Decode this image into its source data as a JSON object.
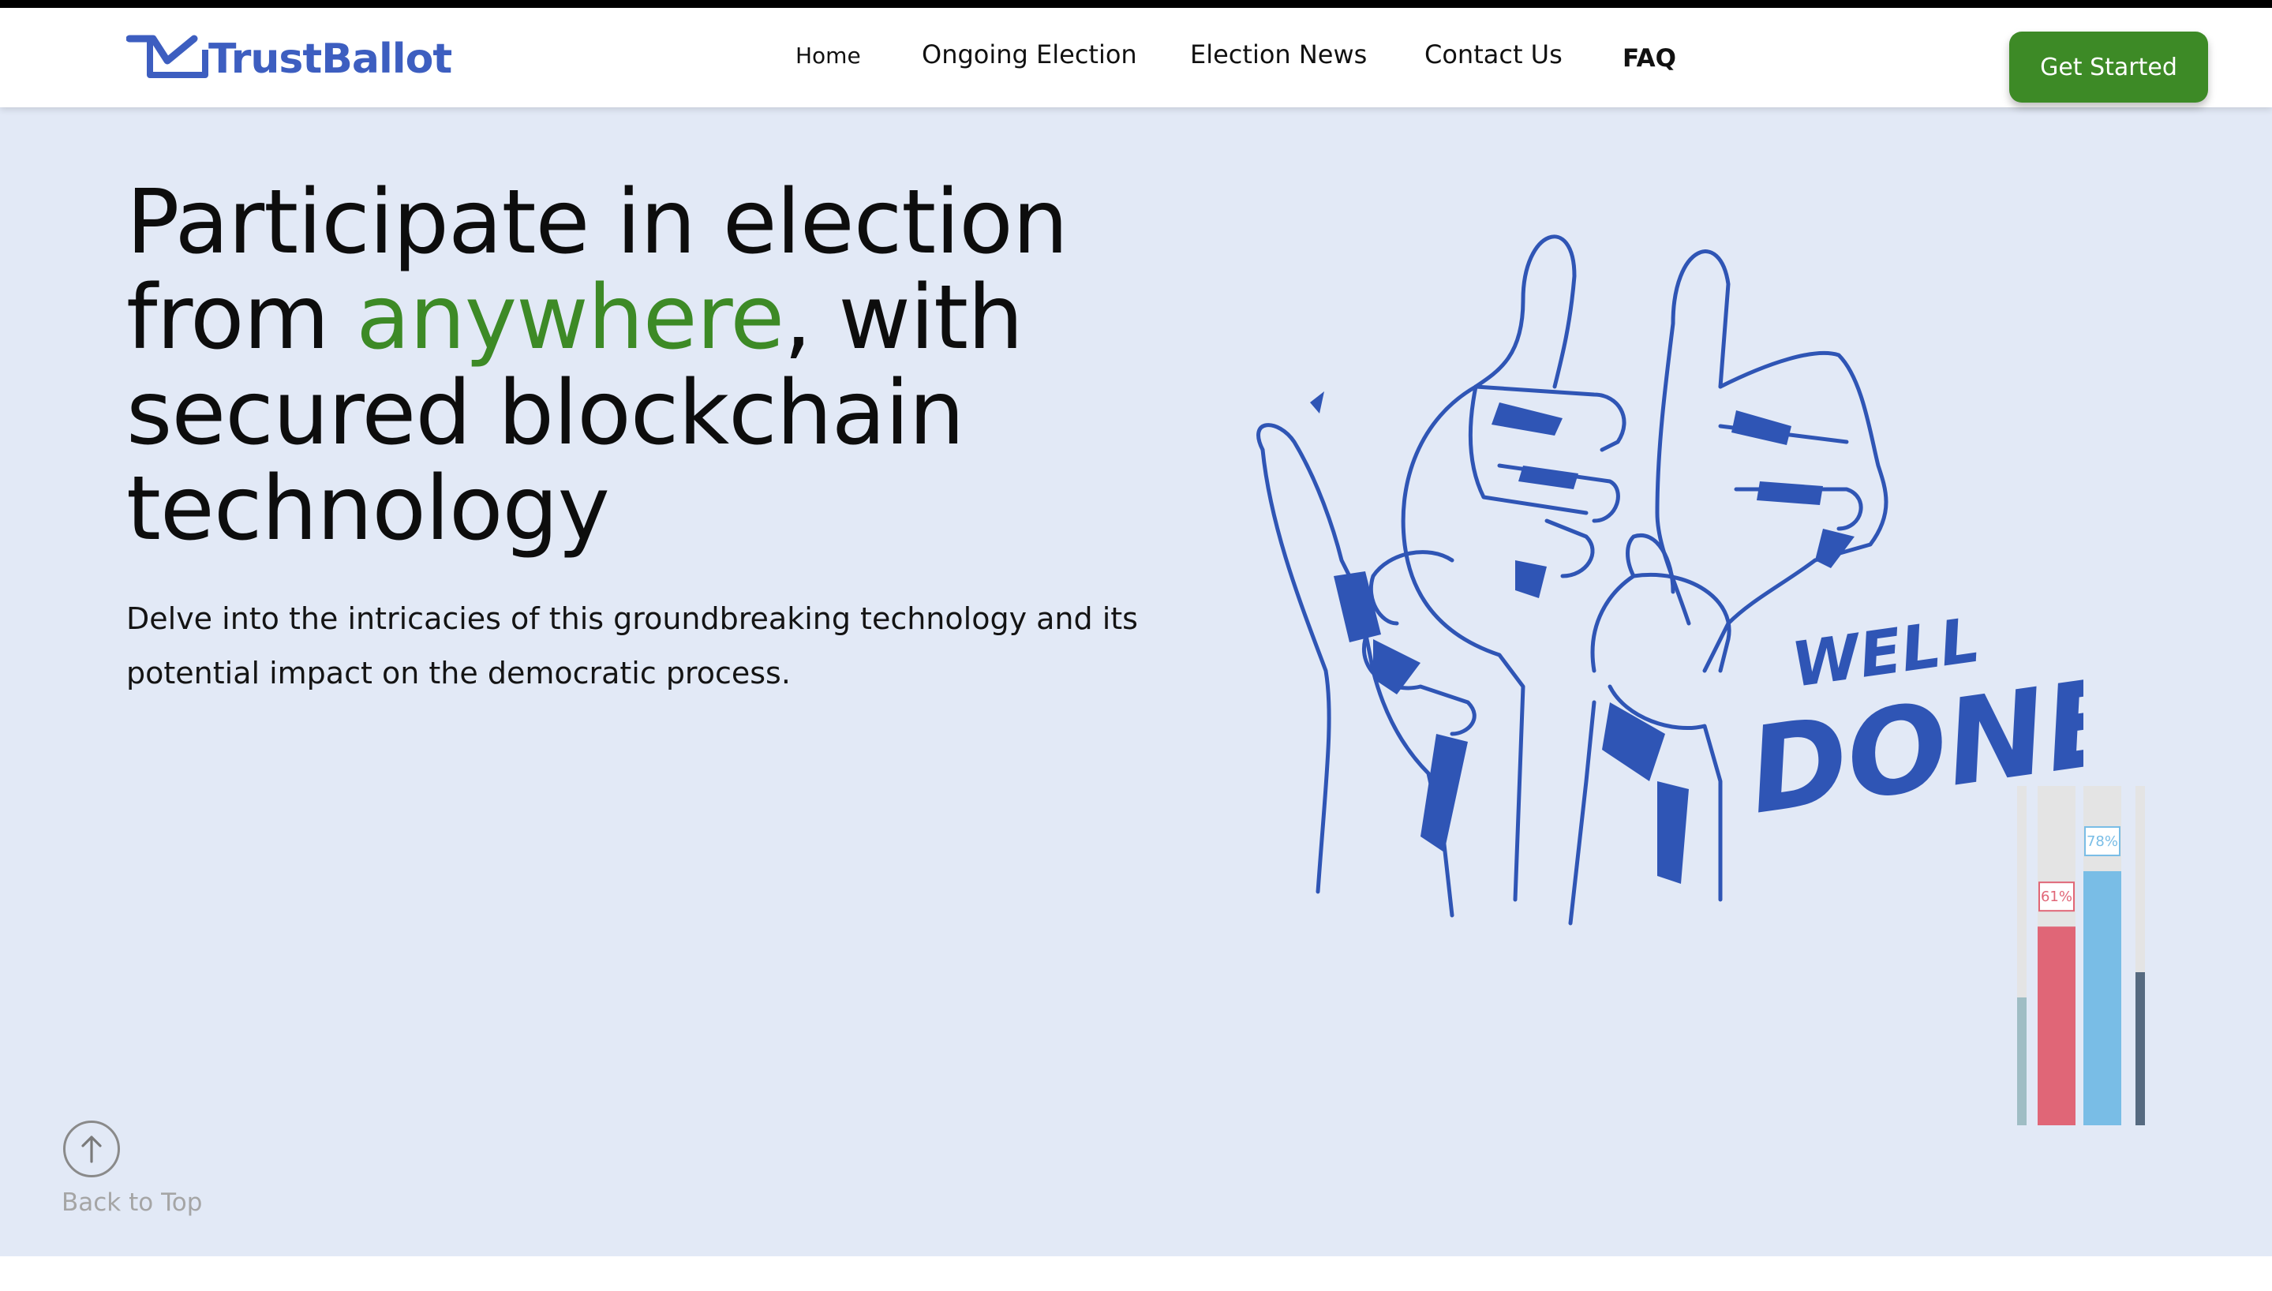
{
  "brand": {
    "name": "TrustBallot",
    "color": "#3d5ec0"
  },
  "nav": {
    "items": [
      {
        "label": "Home"
      },
      {
        "label": "Ongoing Election"
      },
      {
        "label": "Election News"
      },
      {
        "label": "Contact Us"
      },
      {
        "label": "FAQ"
      }
    ],
    "cta_label": "Get Started",
    "cta_color": "#3d8a26"
  },
  "hero": {
    "title_before": "Participate in election from ",
    "title_accent": "anywhere",
    "title_after": ", with secured blockchain technology",
    "accent_color": "#3d8a26",
    "subtitle": "Delve into the intricacies of this groundbreaking technology and its potential impact on the democratic process."
  },
  "illustration": {
    "caption_line1": "WELL",
    "caption_line2": "DONE",
    "ink_color": "#2f55b5",
    "poll_bars": [
      {
        "percent": "61%",
        "value": 61,
        "color": "#e06677"
      },
      {
        "percent": "78%",
        "value": 78,
        "color": "#79bde6"
      }
    ]
  },
  "back_to_top": {
    "label": "Back to Top",
    "icon": "arrow-up-icon"
  }
}
